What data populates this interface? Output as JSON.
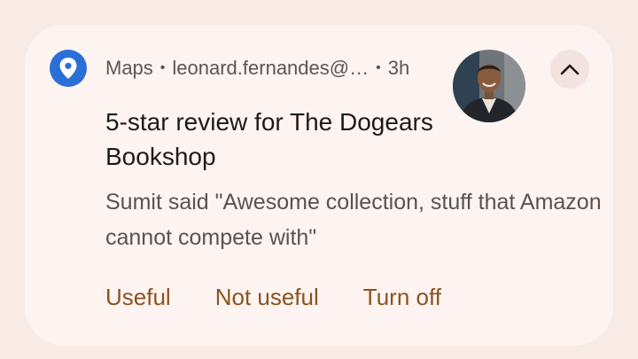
{
  "notification": {
    "app_name": "Maps",
    "separator": "•",
    "account": "leonard.fernandes@…",
    "time": "3h",
    "title": "5-star review for The Dogears Bookshop",
    "body": "Sumit said \"Awesome collection, stuff that Amazon cannot compete with\"",
    "actions": [
      "Useful",
      "Not useful",
      "Turn off"
    ],
    "icons": {
      "app": "maps-pin-icon",
      "expand": "chevron-up-icon"
    },
    "colors": {
      "app_icon_bg": "#2a6fd8",
      "action_text": "#8a5320",
      "card_bg": "#fdf4f1",
      "page_bg": "#f8ebe6"
    }
  }
}
